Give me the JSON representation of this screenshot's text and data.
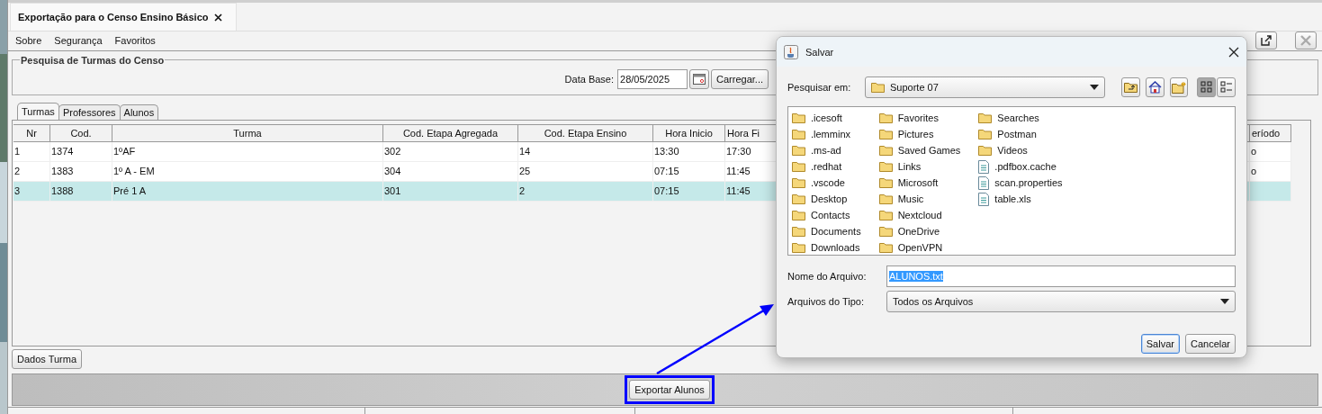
{
  "doc_tab": {
    "title": "Exportação para o Censo Ensino Básico"
  },
  "menu": [
    {
      "label": "Sobre"
    },
    {
      "label": "Segurança"
    },
    {
      "label": "Favoritos"
    }
  ],
  "search_panel": {
    "title": "Pesquisa de Turmas do Censo",
    "date_label": "Data Base:",
    "date_value": "28/05/2025",
    "load_button": "Carregar..."
  },
  "tabs": [
    {
      "label": "Turmas",
      "selected": true
    },
    {
      "label": "Professores",
      "selected": false
    },
    {
      "label": "Alunos",
      "selected": false
    }
  ],
  "table": {
    "columns": [
      "Nr",
      "Cod.",
      "Turma",
      "Cod. Etapa Agregada",
      "Cod. Etapa Ensino",
      "Hora Inicio",
      "Hora Fi",
      "eríodo"
    ],
    "rows": [
      {
        "selected": false,
        "cells": [
          "1",
          "1374",
          "1ºAF",
          "302",
          "14",
          "13:30",
          "17:30",
          "o"
        ]
      },
      {
        "selected": false,
        "cells": [
          "2",
          "1383",
          "1º A - EM",
          "304",
          "25",
          "07:15",
          "11:45",
          "o"
        ]
      },
      {
        "selected": true,
        "cells": [
          "3",
          "1388",
          "Pré 1 A",
          "301",
          "2",
          "07:15",
          "11:45"
        ]
      }
    ]
  },
  "details_button": "Dados Turma",
  "export_button": {
    "label": "Exportar Alunos",
    "highlighted": true
  },
  "dialog": {
    "title": "Salvar",
    "look_in_label": "Pesquisar em:",
    "look_in_value": "Suporte 07",
    "view_buttons": [
      {
        "kind": "list",
        "selected": true
      },
      {
        "kind": "details",
        "selected": false
      }
    ],
    "files": [
      {
        "name": ".icesoft",
        "kind": "folder"
      },
      {
        "name": ".lemminx",
        "kind": "folder"
      },
      {
        "name": ".ms-ad",
        "kind": "folder"
      },
      {
        "name": ".redhat",
        "kind": "folder"
      },
      {
        "name": ".vscode",
        "kind": "folder"
      },
      {
        "name": "Desktop",
        "kind": "folder"
      },
      {
        "name": "Contacts",
        "kind": "folder"
      },
      {
        "name": "Documents",
        "kind": "folder"
      },
      {
        "name": "Downloads",
        "kind": "folder"
      },
      {
        "name": "Favorites",
        "kind": "folder"
      },
      {
        "name": "Pictures",
        "kind": "folder"
      },
      {
        "name": "Saved Games",
        "kind": "folder"
      },
      {
        "name": "Links",
        "kind": "folder"
      },
      {
        "name": "Microsoft",
        "kind": "folder"
      },
      {
        "name": "Music",
        "kind": "folder"
      },
      {
        "name": "Nextcloud",
        "kind": "folder"
      },
      {
        "name": "OneDrive",
        "kind": "folder"
      },
      {
        "name": "OpenVPN",
        "kind": "folder"
      },
      {
        "name": "Searches",
        "kind": "folder"
      },
      {
        "name": "Postman",
        "kind": "folder"
      },
      {
        "name": "Videos",
        "kind": "folder"
      },
      {
        "name": ".pdfbox.cache",
        "kind": "file"
      },
      {
        "name": "scan.properties",
        "kind": "file"
      },
      {
        "name": "table.xls",
        "kind": "file"
      }
    ],
    "file_name_label": "Nome do Arquivo:",
    "file_name_value": "ALUNOS.txt",
    "file_name_text_selected": true,
    "file_type_label": "Arquivos do Tipo:",
    "file_type_value": "Todos os Arquivos",
    "buttons": [
      {
        "label": "Salvar",
        "default": true
      },
      {
        "label": "Cancelar",
        "default": false
      }
    ]
  }
}
